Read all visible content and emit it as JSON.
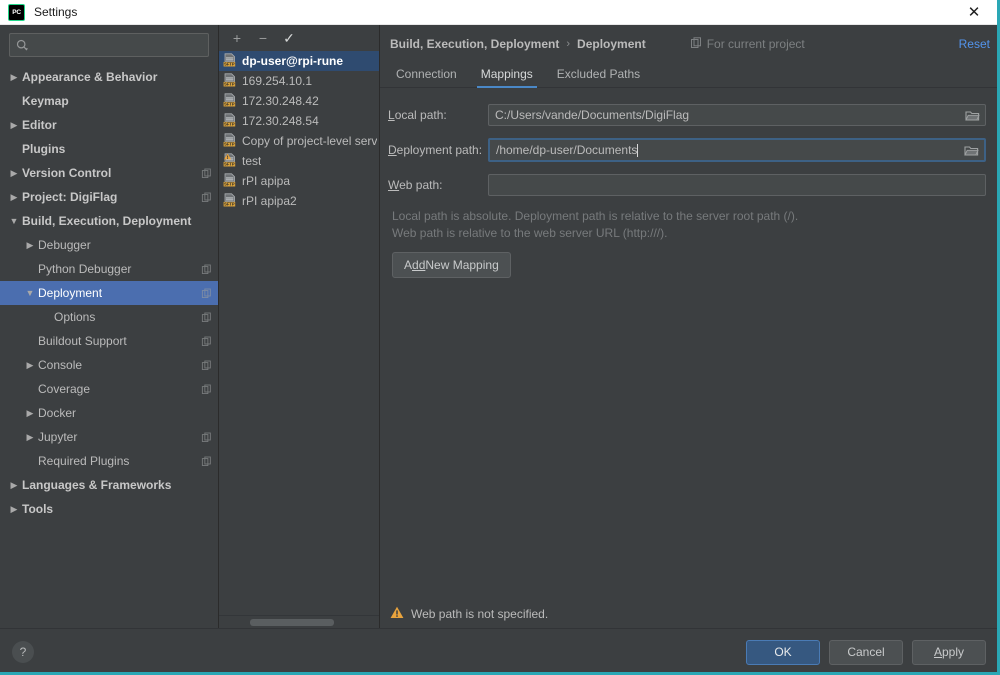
{
  "window": {
    "title": "Settings",
    "logo_text": "PC",
    "close_icon": "close-icon"
  },
  "search": {
    "value": "",
    "placeholder": ""
  },
  "sidebar": {
    "items": [
      {
        "label": "Appearance & Behavior",
        "arrow": "▶",
        "indent": 0,
        "bold": true,
        "copy": false,
        "selected": false
      },
      {
        "label": "Keymap",
        "arrow": "",
        "indent": 0,
        "bold": true,
        "copy": false,
        "selected": false
      },
      {
        "label": "Editor",
        "arrow": "▶",
        "indent": 0,
        "bold": true,
        "copy": false,
        "selected": false
      },
      {
        "label": "Plugins",
        "arrow": "",
        "indent": 0,
        "bold": true,
        "copy": false,
        "selected": false
      },
      {
        "label": "Version Control",
        "arrow": "▶",
        "indent": 0,
        "bold": true,
        "copy": true,
        "selected": false
      },
      {
        "label": "Project: DigiFlag",
        "arrow": "▶",
        "indent": 0,
        "bold": true,
        "copy": true,
        "selected": false
      },
      {
        "label": "Build, Execution, Deployment",
        "arrow": "▼",
        "indent": 0,
        "bold": true,
        "copy": false,
        "selected": false
      },
      {
        "label": "Debugger",
        "arrow": "▶",
        "indent": 1,
        "bold": false,
        "copy": false,
        "selected": false
      },
      {
        "label": "Python Debugger",
        "arrow": "",
        "indent": 1,
        "bold": false,
        "copy": true,
        "selected": false
      },
      {
        "label": "Deployment",
        "arrow": "▼",
        "indent": 1,
        "bold": false,
        "copy": true,
        "selected": true
      },
      {
        "label": "Options",
        "arrow": "",
        "indent": 2,
        "bold": false,
        "copy": true,
        "selected": false
      },
      {
        "label": "Buildout Support",
        "arrow": "",
        "indent": 1,
        "bold": false,
        "copy": true,
        "selected": false
      },
      {
        "label": "Console",
        "arrow": "▶",
        "indent": 1,
        "bold": false,
        "copy": true,
        "selected": false
      },
      {
        "label": "Coverage",
        "arrow": "",
        "indent": 1,
        "bold": false,
        "copy": true,
        "selected": false
      },
      {
        "label": "Docker",
        "arrow": "▶",
        "indent": 1,
        "bold": false,
        "copy": false,
        "selected": false
      },
      {
        "label": "Jupyter",
        "arrow": "▶",
        "indent": 1,
        "bold": false,
        "copy": true,
        "selected": false
      },
      {
        "label": "Required Plugins",
        "arrow": "",
        "indent": 1,
        "bold": false,
        "copy": true,
        "selected": false
      },
      {
        "label": "Languages & Frameworks",
        "arrow": "▶",
        "indent": 0,
        "bold": true,
        "copy": false,
        "selected": false
      },
      {
        "label": "Tools",
        "arrow": "▶",
        "indent": 0,
        "bold": true,
        "copy": false,
        "selected": false
      }
    ]
  },
  "server_panel": {
    "toolbar": {
      "add_label": "+",
      "remove_label": "−",
      "set_default_label": "✓"
    },
    "servers": [
      {
        "label": "dp-user@rpi-rune",
        "selected": true,
        "warning": false
      },
      {
        "label": "169.254.10.1",
        "selected": false,
        "warning": false
      },
      {
        "label": "172.30.248.42",
        "selected": false,
        "warning": false
      },
      {
        "label": "172.30.248.54",
        "selected": false,
        "warning": false
      },
      {
        "label": "Copy of project-level serv",
        "selected": false,
        "warning": false
      },
      {
        "label": "test",
        "selected": false,
        "warning": true
      },
      {
        "label": "rPI apipa",
        "selected": false,
        "warning": false
      },
      {
        "label": "rPI apipa2",
        "selected": false,
        "warning": false
      }
    ],
    "icon_badge": "SFTP"
  },
  "breadcrumb": {
    "parent": "Build, Execution, Deployment",
    "separator": "›",
    "current": "Deployment",
    "scope_text": "For current project",
    "reset_label": "Reset"
  },
  "tabs": [
    {
      "label": "Connection",
      "active": false
    },
    {
      "label": "Mappings",
      "active": true
    },
    {
      "label": "Excluded Paths",
      "active": false
    }
  ],
  "form": {
    "local_path": {
      "label_pre": "",
      "label_mnemonic": "L",
      "label_post": "ocal path:",
      "value": "C:/Users/vande/Documents/DigiFlag",
      "placeholder": ""
    },
    "deployment_path": {
      "label_pre": "",
      "label_mnemonic": "D",
      "label_post": "eployment path:",
      "value": "/home/dp-user/Documents",
      "placeholder": ""
    },
    "web_path": {
      "label_pre": "",
      "label_mnemonic": "W",
      "label_post": "eb path:",
      "value": "",
      "placeholder": ""
    },
    "hint_line1": "Local path is absolute. Deployment path is relative to the server root path (/).",
    "hint_line2": "Web path is relative to the web server URL (http:///).",
    "add_mapping": {
      "pre": "A",
      "mnemonic": "dd",
      "post": " New Mapping"
    }
  },
  "status": {
    "warning_text": "Web path is not specified."
  },
  "footer": {
    "help_label": "?",
    "ok_label": "OK",
    "cancel_label": "Cancel",
    "apply_pre": "",
    "apply_mnemonic": "A",
    "apply_post": "pply"
  },
  "colors": {
    "accent_blue": "#4b6eaf",
    "selection_blue": "#2f4b70",
    "link_blue": "#5394ec",
    "tab_underline": "#4a88c7",
    "warning_orange": "#e8a33d",
    "window_border_teal": "#2aa7b5",
    "panel_bg": "#3c3f41",
    "field_bg": "#45494a"
  }
}
